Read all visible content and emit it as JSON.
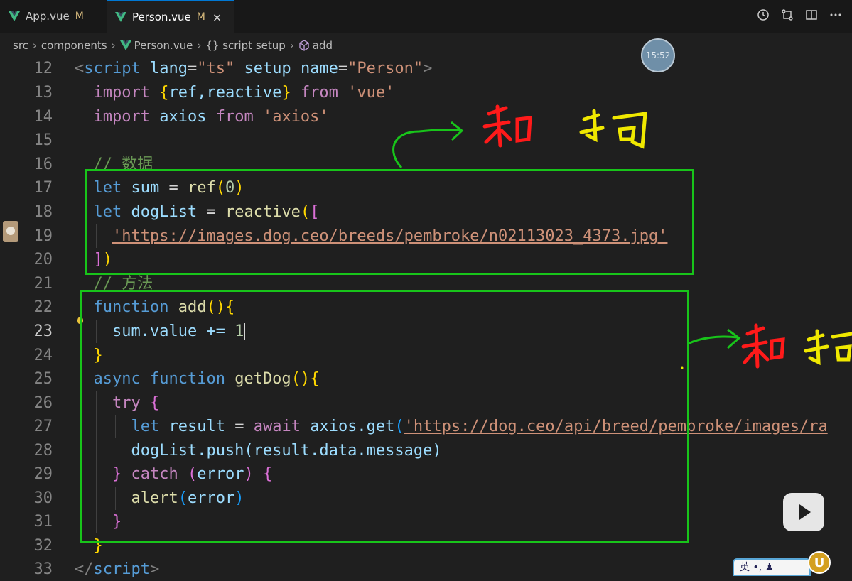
{
  "tabs": [
    {
      "name": "App.vue",
      "modified": "M"
    },
    {
      "name": "Person.vue",
      "modified": "M",
      "close": "×"
    }
  ],
  "breadcrumb": [
    "src",
    "components",
    "Person.vue",
    "{} script setup",
    "add"
  ],
  "clock": "15:52",
  "colors": {
    "green_box": "#18c41a",
    "annotation_red": "#ff1a1a",
    "annotation_yellow": "#f0e800",
    "annotation_green": "#18c41a"
  },
  "editor": {
    "current_line": 23,
    "lines": [
      {
        "n": "12"
      },
      {
        "n": "13"
      },
      {
        "n": "14"
      },
      {
        "n": "15"
      },
      {
        "n": "16"
      },
      {
        "n": "17"
      },
      {
        "n": "18"
      },
      {
        "n": "19"
      },
      {
        "n": "20"
      },
      {
        "n": "21"
      },
      {
        "n": "22"
      },
      {
        "n": "23"
      },
      {
        "n": "24"
      },
      {
        "n": "25"
      },
      {
        "n": "26"
      },
      {
        "n": "27"
      },
      {
        "n": "28"
      },
      {
        "n": "29"
      },
      {
        "n": "30"
      },
      {
        "n": "31"
      },
      {
        "n": "32"
      },
      {
        "n": "33"
      }
    ],
    "text": {
      "script_open_tag": "script",
      "lang_attr": "lang",
      "lang_val": "\"ts\"",
      "setup_attr": "setup",
      "name_attr": "name",
      "name_val": "\"Person\"",
      "import": "import",
      "from": "from",
      "import1_names": "ref,reactive",
      "vue_str": "'vue'",
      "axios_name": "axios",
      "axios_str": "'axios'",
      "comment_data": "// 数据",
      "let": "let",
      "sum": "sum",
      "ref": "ref",
      "zero": "0",
      "dogList": "dogList",
      "reactive": "reactive",
      "dog_url": "'https://images.dog.ceo/breeds/pembroke/n02113023_4373.jpg'",
      "comment_methods": "// 方法",
      "function": "function",
      "add": "add",
      "sum_value": "sum.value += ",
      "one": "1",
      "async": "async",
      "getDog": "getDog",
      "try": "try",
      "result": "result",
      "await": "await",
      "axios_get": "axios.get",
      "api_url": "'https://dog.ceo/api/breed/pembroke/images/ra",
      "push_line": "dogList.push(result.data.message)",
      "catch": "catch",
      "error": "error",
      "alert": "alert",
      "script_close_tag": "script"
    }
  },
  "handwritten": {
    "label_top": "和 狗",
    "label_right": "和 狗"
  }
}
